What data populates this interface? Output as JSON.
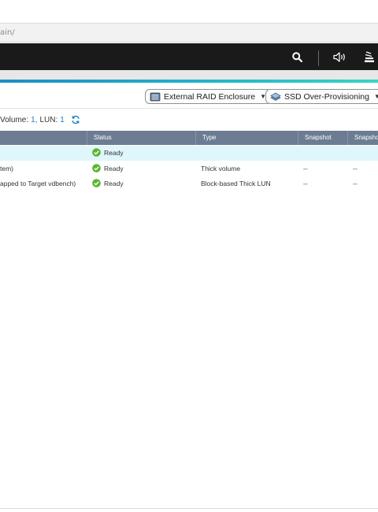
{
  "browser": {
    "url_fragment": "ain/"
  },
  "colors": {
    "accent": "#1a8fc4",
    "ready_green": "#5cb531",
    "header_bg": "#1a1a1a",
    "table_header_bg": "#6c7c92",
    "selected_row_bg": "#dff6fb"
  },
  "header": {
    "icons": [
      "search-icon",
      "volume-icon",
      "stack-icon"
    ]
  },
  "toolbar": {
    "external_raid_label": "External RAID Enclosure",
    "ssd_overprovision_label": "SSD Over-Provisioning"
  },
  "summary": {
    "volume_label": "Volume:",
    "volume_count": "1,",
    "lun_label": "LUN:",
    "lun_count": "1"
  },
  "table": {
    "columns": [
      "",
      "Status",
      "Type",
      "Snapshot",
      "Snapsho"
    ],
    "rows": [
      {
        "name": "",
        "status": "Ready",
        "type": "",
        "snapshot": "",
        "snapshot2": ""
      },
      {
        "name": "tem)",
        "status": "Ready",
        "type": "Thick volume",
        "snapshot": "--",
        "snapshot2": "--"
      },
      {
        "name": "apped to Target vdbench)",
        "status": "Ready",
        "type": "Block-based Thick LUN",
        "snapshot": "--",
        "snapshot2": "--"
      }
    ]
  }
}
